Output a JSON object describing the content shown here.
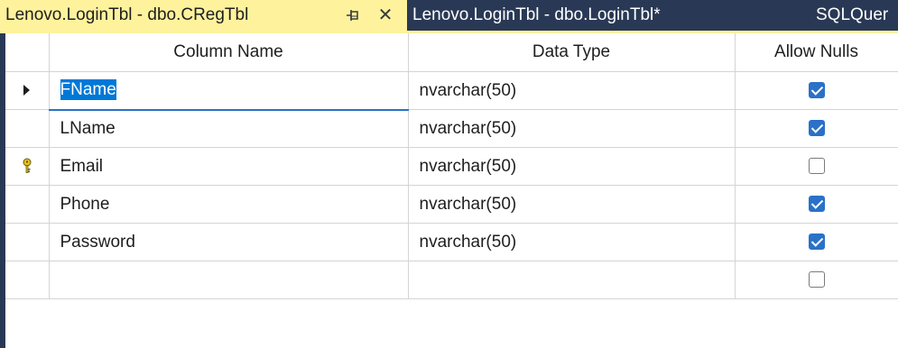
{
  "tabs": [
    {
      "label": "Lenovo.LoginTbl - dbo.CRegTbl",
      "active": true
    },
    {
      "label": "Lenovo.LoginTbl - dbo.LoginTbl*",
      "active": false
    },
    {
      "label": "SQLQuer",
      "active": false
    }
  ],
  "tab_icons": {
    "pin": "pin-icon",
    "close": "close-icon",
    "close_glyph": "✕"
  },
  "columns": {
    "name": "Column Name",
    "type": "Data Type",
    "nulls": "Allow Nulls"
  },
  "rows": [
    {
      "name": "FName",
      "type": "nvarchar(50)",
      "allow_nulls": true,
      "marker": "current-row-arrow"
    },
    {
      "name": "LName",
      "type": "nvarchar(50)",
      "allow_nulls": true,
      "marker": ""
    },
    {
      "name": "Email",
      "type": "nvarchar(50)",
      "allow_nulls": false,
      "marker": "primary-key-icon"
    },
    {
      "name": "Phone",
      "type": "nvarchar(50)",
      "allow_nulls": true,
      "marker": ""
    },
    {
      "name": "Password",
      "type": "nvarchar(50)",
      "allow_nulls": true,
      "marker": ""
    },
    {
      "name": "",
      "type": "",
      "allow_nulls": false,
      "marker": ""
    }
  ],
  "colors": {
    "tab_active_bg": "#fff29d",
    "tab_strip_bg": "#293955",
    "selection": "#0078d7",
    "checkbox_checked": "#2a71c7"
  }
}
